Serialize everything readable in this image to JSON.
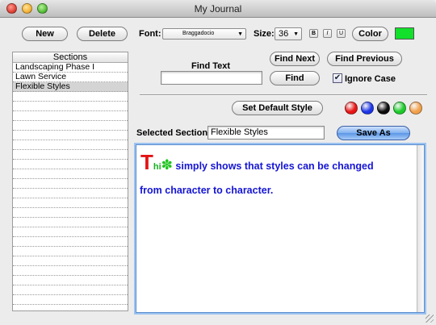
{
  "window": {
    "title": "My Journal"
  },
  "toolbar": {
    "new_label": "New",
    "delete_label": "Delete",
    "font_label": "Font:",
    "font_value": "Braggadocio",
    "size_label": "Size:",
    "size_value": "36",
    "bold_label": "B",
    "italic_label": "I",
    "underline_label": "U",
    "color_label": "Color",
    "color_value": "#12e02a"
  },
  "sections": {
    "header": "Sections",
    "items": [
      "Landscaping Phase I",
      "Lawn Service",
      "Flexible Styles"
    ],
    "selected_index": 2
  },
  "find": {
    "label": "Find Text",
    "value": "",
    "find_next_label": "Find Next",
    "find_previous_label": "Find Previous",
    "find_label": "Find",
    "ignore_case_label": "Ignore Case",
    "ignore_case_checked": true
  },
  "style": {
    "set_default_label": "Set Default Style",
    "colors": [
      "#e81414",
      "#1c35e6",
      "#0c0c0c",
      "#1ccb2a",
      "#f1a04a"
    ]
  },
  "selected_section": {
    "label": "Selected Section:",
    "value": "Flexible Styles",
    "save_as_label": "Save As"
  },
  "editor": {
    "chars": [
      {
        "text": "T",
        "color": "#e31313"
      },
      {
        "text": "hi",
        "color": "#16b020"
      },
      {
        "text": "✽",
        "color": "#1ec41e"
      },
      {
        "text": " simply shows that styles can be changed",
        "color": "#1515d4"
      }
    ],
    "line2": "from character to character."
  }
}
